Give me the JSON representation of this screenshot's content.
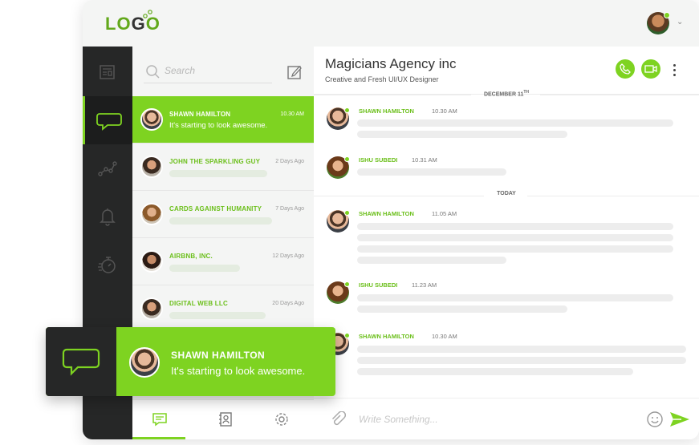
{
  "logo": {
    "text_a": "L",
    "text_b": "G",
    "text_o1": "O",
    "text_o2": "O"
  },
  "search": {
    "placeholder": "Search"
  },
  "conversations": [
    {
      "name": "SHAWN HAMILTON",
      "time": "10.30 AM",
      "snippet": "It's starting to look awesome."
    },
    {
      "name": "JOHN THE SPARKLING GUY",
      "time": "2 Days Ago"
    },
    {
      "name": "CARDS AGAINST HUMANITY",
      "time": "7 Days Ago"
    },
    {
      "name": "AIRBNB, INC.",
      "time": "12 Days Ago"
    },
    {
      "name": "DIGITAL WEB LLC",
      "time": "20 Days Ago"
    }
  ],
  "chat": {
    "title": "Magicians Agency inc",
    "subtitle": "Creative and Fresh UI/UX Designer",
    "date_1": "DECEMBER 11",
    "date_1_sup": "TH",
    "date_2": "TODAY",
    "messages": [
      {
        "sender": "SHAWN HAMILTON",
        "time": "10.30 AM"
      },
      {
        "sender": "ISHU SUBEDI",
        "time": "10.31 AM"
      },
      {
        "sender": "SHAWN HAMILTON",
        "time": "11.05 AM"
      },
      {
        "sender": "ISHU SUBEDI",
        "time": "11.23 AM"
      },
      {
        "sender": "SHAWN HAMILTON",
        "time": "10.30 AM"
      }
    ],
    "composer_placeholder": "Write Something..."
  },
  "toast": {
    "name": "SHAWN HAMILTON",
    "text": "It's starting to look awesome."
  },
  "colors": {
    "accent": "#7ed321",
    "rail": "#262727",
    "panel": "#f4f5f4"
  },
  "icons": [
    "newspaper-icon",
    "chat-bubble-icon",
    "growth-chart-icon",
    "bell-icon",
    "stopwatch-icon",
    "search-icon",
    "compose-icon",
    "phone-icon",
    "video-icon",
    "more-icon",
    "chat-icon",
    "contacts-icon",
    "settings-icon",
    "paperclip-icon",
    "smiley-icon",
    "send-icon"
  ]
}
